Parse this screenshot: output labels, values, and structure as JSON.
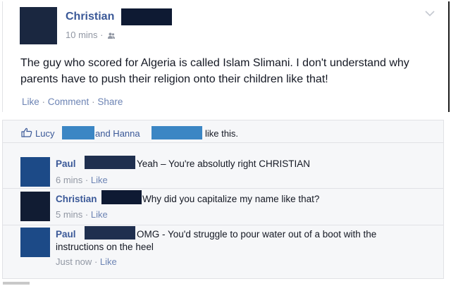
{
  "post": {
    "author": "Christian",
    "time": "10 mins",
    "meta_separator": "·",
    "privacy_icon": "friends-icon",
    "text": "The guy who scored for Algeria is called Islam Slimani. I don't understand why parents have to push their religion onto their children like that!",
    "actions": {
      "like": "Like",
      "comment": "Comment",
      "share": "Share",
      "separator": "·"
    }
  },
  "likes": {
    "first_name": "Lucy",
    "connector": "and Hanna",
    "suffix": "like this."
  },
  "comments": [
    {
      "author": "Paul",
      "text": "Yeah – You're absolutly right CHRISTIAN",
      "time": "6 mins",
      "like": "Like"
    },
    {
      "author": "Christian",
      "text": "Why did you capitalize my name like that?",
      "time": "5 mins",
      "like": "Like"
    },
    {
      "author": "Paul",
      "text_line1": "OMG - You'd struggle to pour water out of a boot with the",
      "text_line2": "instructions on the heel",
      "time": "Just now",
      "like": "Like"
    }
  ],
  "colors": {
    "link_blue": "#3b5998",
    "redaction_dark": "#0e1a33",
    "redaction_blue": "#3b86c4",
    "meta_gray": "#9197a3"
  }
}
